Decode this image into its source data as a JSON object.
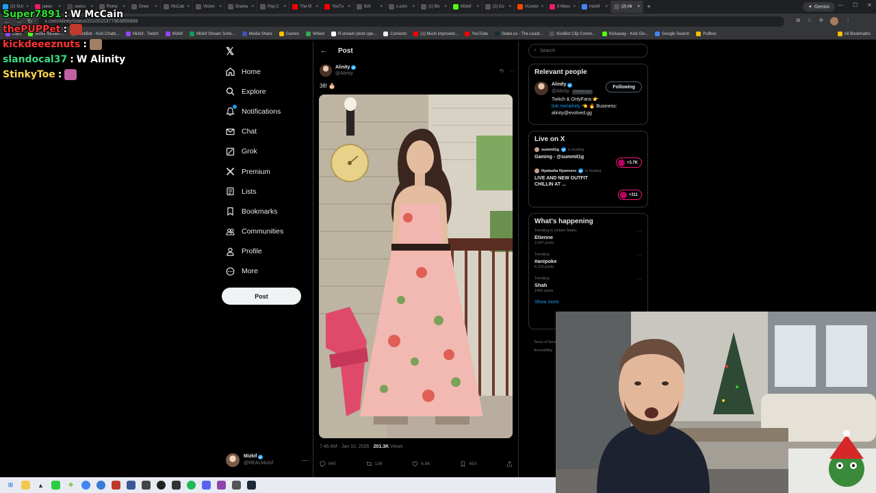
{
  "browser": {
    "tabs": [
      {
        "label": "(2) SUr",
        "color": "#1da1f2"
      },
      {
        "label": "jaeez",
        "color": "#e91e63"
      },
      {
        "label": "ceeco",
        "color": "#444"
      },
      {
        "label": "Romy",
        "color": "#555"
      },
      {
        "label": "Drew",
        "color": "#555"
      },
      {
        "label": "McCab",
        "color": "#555"
      },
      {
        "label": "Victori",
        "color": "#555"
      },
      {
        "label": "Drama",
        "color": "#555"
      },
      {
        "label": "Pop C",
        "color": "#555"
      },
      {
        "label": "The M",
        "color": "#ff0000"
      },
      {
        "label": "YouTu",
        "color": "#ff0000"
      },
      {
        "label": "BAI",
        "color": "#555"
      },
      {
        "label": "x.com",
        "color": "#555"
      },
      {
        "label": "(1) Bo",
        "color": "#555"
      },
      {
        "label": "Mizkif",
        "color": "#53fc18"
      },
      {
        "label": "(2) Co",
        "color": "#555"
      },
      {
        "label": "r/Livest",
        "color": "#ff4500"
      },
      {
        "label": "8 Mess",
        "color": "#e91e63"
      },
      {
        "label": "mizkif",
        "color": "#4285f4"
      },
      {
        "label": "(2) Ali",
        "color": "#555",
        "active": true
      }
    ],
    "new_tab": "+",
    "gemini": "Gemini",
    "url": "x.com/Alinity/status/2010015377963855888",
    "bookmarks": [
      {
        "label": "Clips",
        "color": "#9146ff"
      },
      {
        "label": "Mizkif Stream ...",
        "color": "#53fc18"
      },
      {
        "label": "KickBot - Kick Chatb...",
        "color": "#555"
      },
      {
        "label": "Mizkif - Twitch",
        "color": "#9146ff"
      },
      {
        "label": "Mizkif",
        "color": "#9146ff"
      },
      {
        "label": "Mizkif Stream Sche...",
        "color": "#0f9d58"
      },
      {
        "label": "Media Share",
        "color": "#3f51b5"
      },
      {
        "label": "Games",
        "color": "#fbbc05"
      },
      {
        "label": "Wheel",
        "color": "#34a853"
      },
      {
        "label": "R.stream (dont ope...",
        "color": "#fff"
      },
      {
        "label": "Contexto",
        "color": "#eee"
      },
      {
        "label": "(1) Much improved...",
        "color": "#ff0000"
      },
      {
        "label": "YouTube",
        "color": "#ff0000"
      },
      {
        "label": "Stake.us - The Leadi...",
        "color": "#1a2c38"
      },
      {
        "label": "KickBot Clip Comm...",
        "color": "#555"
      },
      {
        "label": "Kickaway - Kick Giv...",
        "color": "#53fc18"
      },
      {
        "label": "Google Search",
        "color": "#4285f4"
      },
      {
        "label": "Pullbox",
        "color": "#fbbc05"
      }
    ],
    "all_bookmarks": "All Bookmarks"
  },
  "chat": [
    {
      "user": "Super7891",
      "message": "W McCain",
      "color": "#2ee02e"
    },
    {
      "user": "thePUPPet",
      "message": "",
      "color": "#ff3333"
    },
    {
      "user": "kickdeeeznuts",
      "message": "",
      "color": "#ff3333"
    },
    {
      "user": "slandocal37",
      "message": "W Alinity",
      "color": "#3ddc84"
    },
    {
      "user": "StinkyToe",
      "message": "",
      "color": "#ffd84d"
    }
  ],
  "nav": {
    "items": [
      {
        "label": "Home",
        "icon": "home-icon"
      },
      {
        "label": "Explore",
        "icon": "search-icon"
      },
      {
        "label": "Notifications",
        "icon": "bell-icon"
      },
      {
        "label": "Chat",
        "icon": "mail-icon"
      },
      {
        "label": "Grok",
        "icon": "grok-icon"
      },
      {
        "label": "Premium",
        "icon": "x-premium-icon"
      },
      {
        "label": "Lists",
        "icon": "list-icon"
      },
      {
        "label": "Bookmarks",
        "icon": "bookmark-icon"
      },
      {
        "label": "Communities",
        "icon": "people-icon"
      },
      {
        "label": "Profile",
        "icon": "person-icon"
      },
      {
        "label": "More",
        "icon": "more-circle-icon"
      }
    ],
    "post_button": "Post",
    "account": {
      "name": "Mizkif",
      "handle": "@REALMizkif"
    }
  },
  "post": {
    "header": "Post",
    "author": {
      "name": "Alinity",
      "handle": "@Alinity"
    },
    "text": "38! 🎂",
    "timestamp": "7:46 AM · Jan 10, 2026 · ",
    "views_count": "201.3K",
    "views_label": " Views",
    "actions": {
      "replies": "645",
      "reposts": "136",
      "likes": "6.8K",
      "bookmarks": "693"
    }
  },
  "sidebar": {
    "search_placeholder": "Search",
    "relevant": {
      "title": "Relevant people",
      "name": "Alinity",
      "handle": "@Alinity",
      "follows_you": "Follows you",
      "follow_button": "Following",
      "bio_text": "Twitch ",
      "bio_link": "link.me/alinity",
      "bio_rest_1": " & OnlyFans 👉",
      "bio_rest_2": " 👈 🔥 Business: alinity@evolved.gg"
    },
    "live": {
      "title": "Live on X",
      "items": [
        {
          "host": "summit1g",
          "hosting": "is hosting",
          "title": "Gaming - @summit1g",
          "count": "+3.7K"
        },
        {
          "host": "Nyatasha Nyanners",
          "hosting": "is hosting",
          "title": "LIVE AND NEW OUTFIT CHILLIN AT ...",
          "count": "+311"
        }
      ]
    },
    "happening": {
      "title": "What's happening",
      "trends": [
        {
          "category": "Trending in United States",
          "name": "Etienne",
          "count": "2,547 posts"
        },
        {
          "category": "Trending",
          "name": "#anipoke",
          "count": "6,119 posts"
        },
        {
          "category": "Trending",
          "name": "Shah",
          "count": "145K posts"
        }
      ],
      "show_more": "Show more"
    },
    "footer": [
      "Terms of Service",
      "Accessibility"
    ]
  }
}
